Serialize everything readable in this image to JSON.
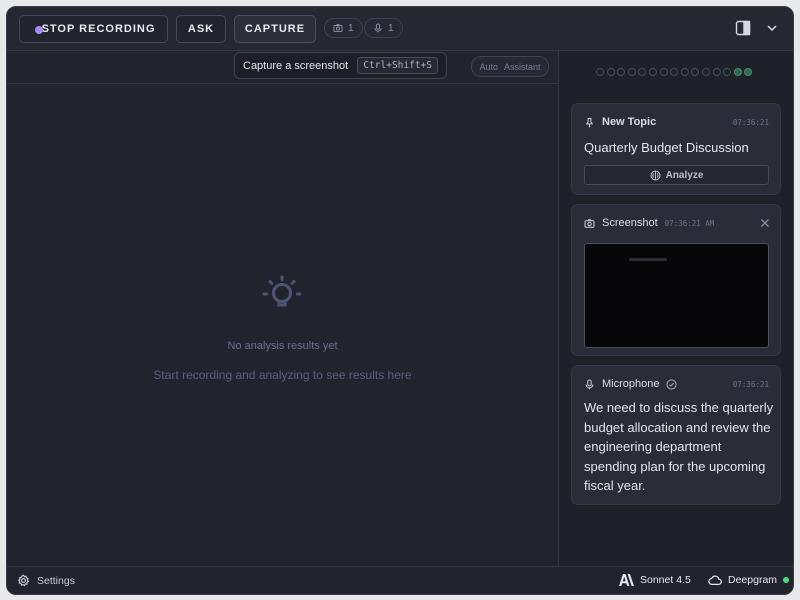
{
  "toolbar": {
    "stop_label": "STOP RECORDING",
    "ask_label": "ASK",
    "capture_label": "CAPTURE",
    "screenshot_count": "1",
    "mic_count": "1",
    "recording_dot_color": "#a78bfa"
  },
  "tooltip": {
    "text": "Capture a screenshot",
    "shortcut": "Ctrl+Shift+S"
  },
  "mode": {
    "auto_label": "Auto",
    "assistant_label": "Assistant"
  },
  "empty_state": {
    "title": "No analysis results yet",
    "subtitle": "Start recording and analyzing to see results here",
    "icon": "lightbulb-icon"
  },
  "right_panel": {
    "progress_dots": {
      "total": 15,
      "active": 2,
      "active_color": "#2f6b4f"
    },
    "cards": [
      {
        "type": "topic",
        "title": "New Topic",
        "time": "07:36:21",
        "topic": "Quarterly Budget Discussion",
        "action_label": "Analyze"
      },
      {
        "type": "screenshot",
        "title": "Screenshot",
        "time": "07:36:21 AM"
      },
      {
        "type": "microphone",
        "title": "Microphone",
        "time": "07:36:21",
        "text": "We need to discuss the quarterly budget allocation and review the engineering department spending plan for the upcoming fiscal year."
      }
    ]
  },
  "footer": {
    "settings_label": "Settings",
    "model_label": "Sonnet 4.5",
    "transcriber_label": "Deepgram",
    "status_color": "#4ade80"
  }
}
